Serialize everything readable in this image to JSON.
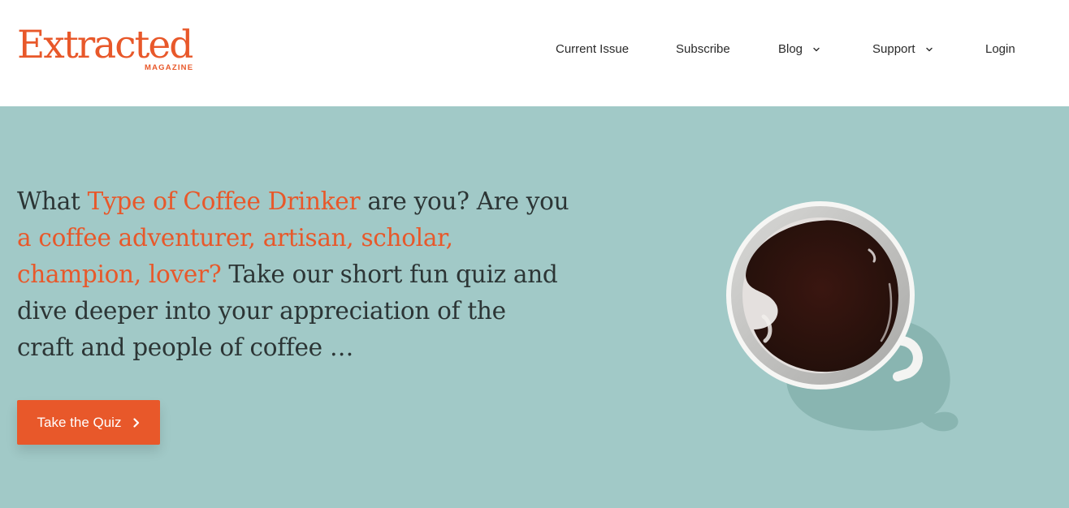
{
  "header": {
    "logo": {
      "word": "Extracted",
      "sub": "MAGAZINE"
    },
    "nav": [
      {
        "label": "Current Issue",
        "has_dropdown": false
      },
      {
        "label": "Subscribe",
        "has_dropdown": false
      },
      {
        "label": "Blog",
        "has_dropdown": true
      },
      {
        "label": "Support",
        "has_dropdown": true
      },
      {
        "label": "Login",
        "has_dropdown": false
      }
    ]
  },
  "hero": {
    "segments": [
      {
        "text": "What ",
        "accent": false
      },
      {
        "text": "Type of Coffee Drinker",
        "accent": true
      },
      {
        "text": " are you? Are you ",
        "accent": false
      },
      {
        "text": "a coffee adventurer, artisan, scholar, champion, lover?",
        "accent": true
      },
      {
        "text": " Take our short fun quiz and dive deeper into your appreciation of the craft and people of coffee …",
        "accent": false
      }
    ],
    "button_label": "Take the Quiz"
  },
  "colors": {
    "accent": "#e8582a",
    "hero_bg": "#a1c9c7",
    "header_bg": "#ffffff",
    "text_dark": "#2c3535"
  },
  "icons": {
    "dropdown": "chevron-down-icon",
    "button_arrow": "chevron-right-icon"
  }
}
